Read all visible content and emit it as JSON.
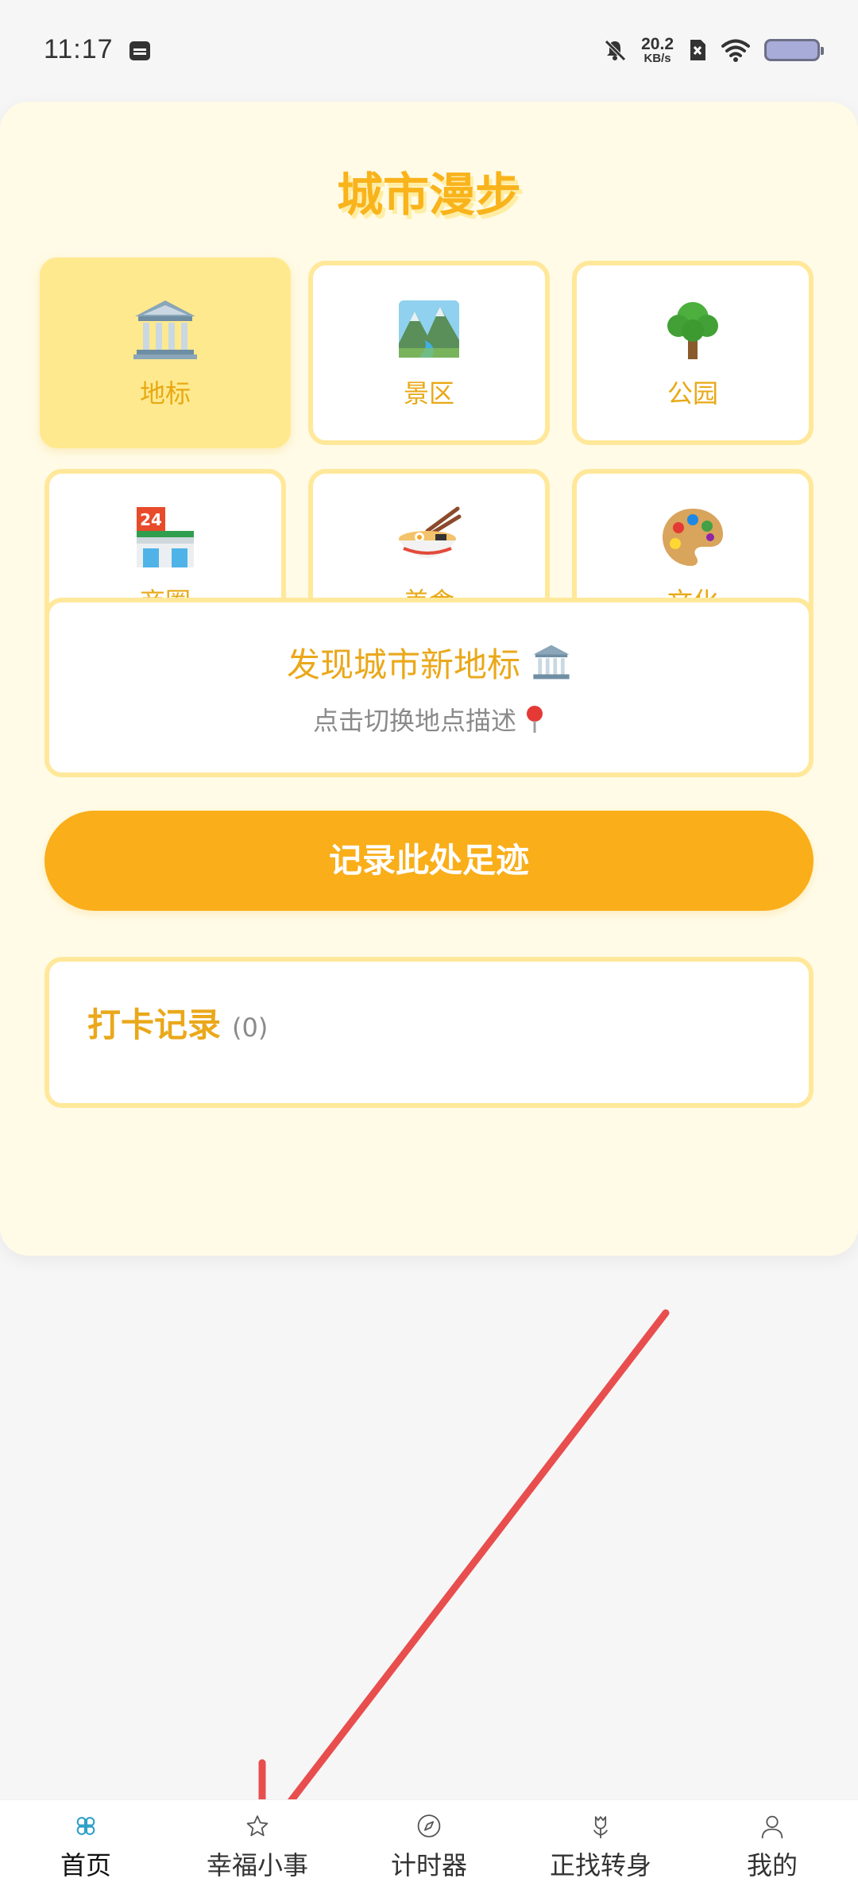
{
  "status_bar": {
    "time": "11:17",
    "net_speed_value": "20.2",
    "net_speed_unit": "KB/s"
  },
  "page": {
    "title": "城市漫步"
  },
  "categories": [
    {
      "label": "地标",
      "icon": "classical-building-icon",
      "active": true
    },
    {
      "label": "景区",
      "icon": "scenic-landscape-icon",
      "active": false
    },
    {
      "label": "公园",
      "icon": "tree-icon",
      "active": false
    },
    {
      "label": "商圈",
      "icon": "convenience-store-icon",
      "active": false
    },
    {
      "label": "美食",
      "icon": "noodle-bowl-icon",
      "active": false
    },
    {
      "label": "文化",
      "icon": "palette-icon",
      "active": false
    }
  ],
  "discover": {
    "title": "发现城市新地标",
    "subtitle": "点击切换地点描述"
  },
  "record_button": {
    "label": "记录此处足迹"
  },
  "checkin": {
    "title": "打卡记录",
    "count": "(0)"
  },
  "bottom_nav": {
    "items": [
      {
        "label": "首页",
        "icon": "clover-icon",
        "active": true
      },
      {
        "label": "幸福小事",
        "icon": "star-icon",
        "active": false
      },
      {
        "label": "计时器",
        "icon": "compass-icon",
        "active": false
      },
      {
        "label": "正找转身",
        "icon": "tulip-icon",
        "active": false
      },
      {
        "label": "我的",
        "icon": "person-icon",
        "active": false
      }
    ]
  },
  "colors": {
    "accent": "#f9ae1a",
    "title": "#f9b31b",
    "card_bg": "#fffbe7",
    "tile_border": "#ffe89a",
    "active_tile": "#ffe98e",
    "nav_active": "#2fa0c8",
    "annotation_arrow": "#e84e4e"
  }
}
